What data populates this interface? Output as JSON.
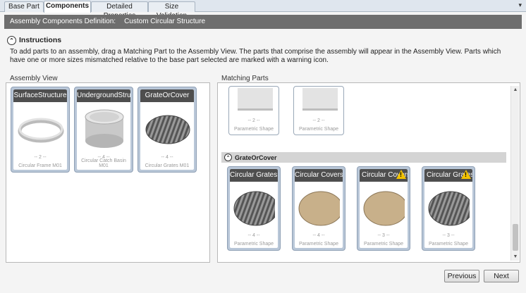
{
  "tabs": [
    "Base Part",
    "Components",
    "Detailed Properties",
    "Size Validation"
  ],
  "definition": {
    "label": "Assembly Components Definition:",
    "value": "Custom Circular Structure"
  },
  "instructions": {
    "title": "Instructions",
    "text": "To add parts to an assembly, drag a Matching Part to the Assembly View. The parts that comprise the assembly will appear in the Assembly View. Parts which have one or more sizes mismatched relative to the base part selected are marked with a warning icon."
  },
  "assembly_view": {
    "label": "Assembly View",
    "cards": [
      {
        "title": "SurfaceStructure",
        "count": "-- 2 --",
        "sub": "Circular Frame M01",
        "image": "ring-icon"
      },
      {
        "title": "UndergroundStruc...",
        "count": "-- 4 --",
        "sub": "Circular Catch Basin M01",
        "image": "cylinder-icon"
      },
      {
        "title": "GrateOrCover",
        "count": "-- 4 --",
        "sub": "Circular Grates M01",
        "image": "grate-icon"
      }
    ]
  },
  "matching_parts": {
    "label": "Matching Parts",
    "top_cards": [
      {
        "count": "-- 2 --",
        "sub": "Parametric Shape"
      },
      {
        "count": "-- 2 --",
        "sub": "Parametric Shape"
      }
    ],
    "group": {
      "title": "GrateOrCover"
    },
    "cards": [
      {
        "title": "Circular Grates...",
        "count": "-- 4 --",
        "sub": "Parametric Shape",
        "image": "grate-icon",
        "warning": false
      },
      {
        "title": "Circular Covers...",
        "count": "-- 4 --",
        "sub": "Parametric Shape",
        "image": "cover-icon",
        "warning": false
      },
      {
        "title": "Circular Covers",
        "count": "-- 3 --",
        "sub": "Parametric Shape",
        "image": "cover-icon",
        "warning": true
      },
      {
        "title": "Circular Grates",
        "count": "-- 3 --",
        "sub": "Parametric Shape",
        "image": "grate-icon",
        "warning": true
      }
    ]
  },
  "buttons": {
    "previous": "Previous",
    "next": "Next"
  },
  "colors": {
    "title_bar": "#6e6e6e",
    "card_header": "#4e4e4e",
    "card_frame": "#b9c7d8",
    "warning": "#f2c200",
    "cover": "#c8b08a"
  }
}
